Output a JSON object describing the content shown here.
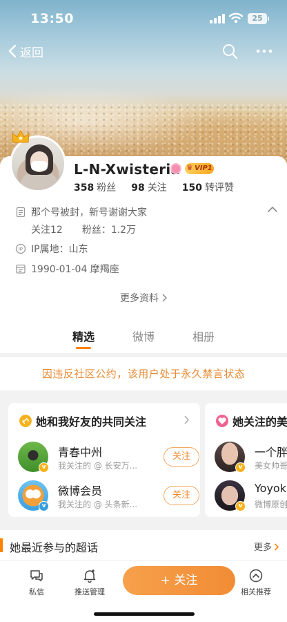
{
  "status_bar": {
    "time": "13:50",
    "battery": "25"
  },
  "nav": {
    "back_label": "返回"
  },
  "profile": {
    "nickname": "L-N-Xwisteria",
    "vip_label": "VIP1",
    "stats": [
      {
        "value": "358",
        "label": "粉丝"
      },
      {
        "value": "98",
        "label": "关注"
      },
      {
        "value": "150",
        "label": "转评赞"
      }
    ],
    "bio": "那个号被封，新号谢谢大家",
    "follow_count_text": "关注12",
    "fans_count_text": "粉丝：1.2万",
    "ip_location": "IP属地：山东",
    "birthday": "1990-01-04 摩羯座",
    "more_info": "更多资料"
  },
  "tabs": [
    {
      "label": "精选",
      "active": true
    },
    {
      "label": "微博",
      "active": false
    },
    {
      "label": "相册",
      "active": false
    }
  ],
  "ban_notice": "因违反社区公约，该用户处于永久禁言状态",
  "common_follows": {
    "title": "她和我好友的共同关注",
    "people": [
      {
        "name": "青春中州",
        "desc": "我关注的 @ 长安万...",
        "button": "关注"
      },
      {
        "name": "微博会员",
        "desc": "我关注的 @ 头条新...",
        "button": "关注"
      }
    ]
  },
  "her_follows": {
    "title": "她关注的美",
    "people": [
      {
        "name": "一个胖",
        "desc": "美女帅哥"
      },
      {
        "name": "Yoyoki",
        "desc": "微博原创"
      }
    ]
  },
  "super_topic": {
    "title": "她最近参与的超话",
    "more": "更多"
  },
  "bottom_bar": {
    "message": "私信",
    "push": "推送管理",
    "follow_button": "+ 关注",
    "related": "相关推荐"
  },
  "colors": {
    "accent": "#ff8200",
    "ban_text": "#e88a33",
    "follow_gradient": "#f28c35"
  }
}
